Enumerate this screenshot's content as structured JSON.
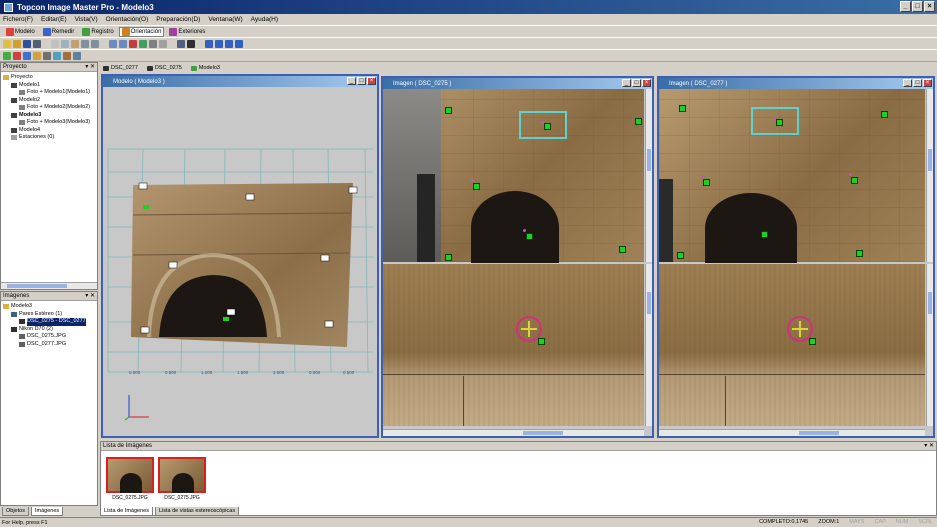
{
  "window": {
    "title": "Topcon Image Master Pro - Modelo3",
    "min": "_",
    "max": "□",
    "close": "×"
  },
  "menu": [
    "Fichero(F)",
    "Editar(E)",
    "Vista(V)",
    "Orientación(O)",
    "Preparación(D)",
    "Ventana(W)",
    "Ayuda(H)"
  ],
  "toolbar_tabs": [
    {
      "label": "Modelo",
      "color": "#e04040"
    },
    {
      "label": "Remedir",
      "color": "#4060d0"
    },
    {
      "label": "Registro",
      "color": "#40a040"
    },
    {
      "label": "Orientación",
      "color": "#d08020",
      "active": true
    },
    {
      "label": "Exteriores",
      "color": "#a040a0"
    }
  ],
  "project_panel": {
    "title": "Proyecto",
    "items": [
      {
        "label": "Proyecto",
        "level": 0,
        "bold": false
      },
      {
        "label": "Modelo1",
        "level": 1,
        "bold": false
      },
      {
        "label": "Foto + Modelo1(Modelo1)",
        "level": 2,
        "bold": false
      },
      {
        "label": "Modelo2",
        "level": 1,
        "bold": false
      },
      {
        "label": "Foto + Modelo2(Modelo2)",
        "level": 2,
        "bold": false
      },
      {
        "label": "Modelo3",
        "level": 1,
        "bold": true
      },
      {
        "label": "Foto + Modelo3(Modelo3)",
        "level": 2,
        "bold": false
      },
      {
        "label": "Modelo4",
        "level": 1,
        "bold": false
      },
      {
        "label": "Estaciones (0)",
        "level": 1,
        "bold": false
      }
    ]
  },
  "images_panel": {
    "title": "Imágenes",
    "items": [
      {
        "label": "Modelo3",
        "level": 0,
        "selected": false
      },
      {
        "label": "Pares Estéreo (1)",
        "level": 1,
        "selected": false
      },
      {
        "label": "DSC_0275 - DSC_0277",
        "level": 2,
        "selected": true
      },
      {
        "label": "Nikon D70 (2)",
        "level": 1,
        "selected": false
      },
      {
        "label": "DSC_0275.JPG",
        "level": 2,
        "selected": false
      },
      {
        "label": "DSC_0277.JPG",
        "level": 2,
        "selected": false
      }
    ]
  },
  "doc_tabs": [
    "DSC_0277",
    "DSC_0275",
    "Modelo3"
  ],
  "views": {
    "model": {
      "title": "Modelo ( Modelo3 )",
      "axis_ticks": [
        "0.000",
        "0.500",
        "1.000",
        "1.500",
        "2.000"
      ],
      "rear_ticks": [
        "0.000",
        "0.500"
      ]
    },
    "image_left": {
      "title": "Imagen ( DSC_0275 )"
    },
    "image_right": {
      "title": "Imagen ( DSC_0277 )"
    }
  },
  "image_list": {
    "title": "Lista de Imágenes",
    "thumbs": [
      "DSC_0275.JPG",
      "DSC_0275.JPG"
    ],
    "tabs": [
      "Lista de Imágenes",
      "Lista de vistas estereoscópicas"
    ]
  },
  "left_tabs": [
    "Objetos",
    "Imágenes"
  ],
  "status": {
    "left": "For Help, press F1",
    "items": [
      {
        "text": "COMPLETO:0,1745",
        "dim": false
      },
      {
        "text": "ZOOM:1",
        "dim": false
      },
      {
        "text": "MAYS",
        "dim": true
      },
      {
        "text": "CAP",
        "dim": true
      },
      {
        "text": "NUM",
        "dim": true
      },
      {
        "text": "SCRL",
        "dim": true
      }
    ]
  },
  "colors": {
    "title_bar": "#0a246a",
    "view_border": "#3d5fb6",
    "marker": "#20d020",
    "selection_box": "#5fd0d0",
    "cursor_circle": "#d03080"
  }
}
